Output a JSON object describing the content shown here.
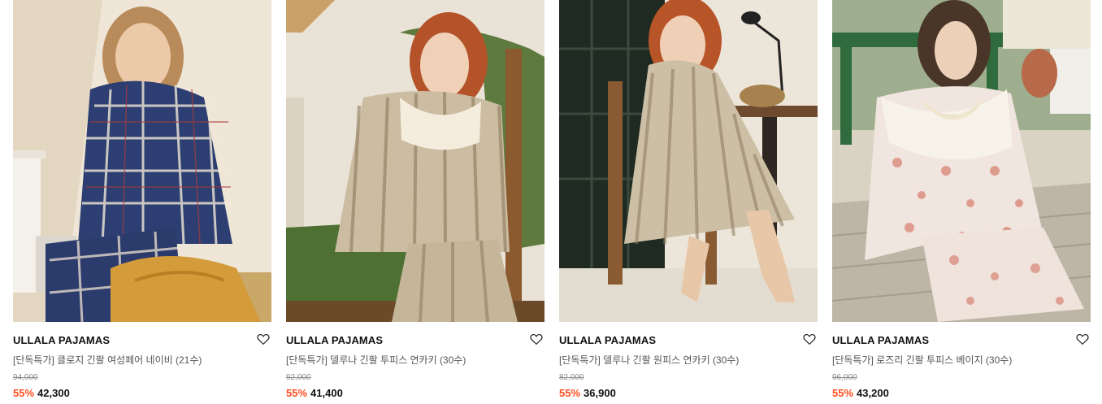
{
  "products": [
    {
      "brand": "ULLALA PAJAMAS",
      "title": "[단독특가] 클로지 긴팔 여성페어 네이비 (21수)",
      "original_price": "94,000",
      "discount_rate": "55%",
      "sale_price": "42,300",
      "wishlist_icon": "heart-outline-icon"
    },
    {
      "brand": "ULLALA PAJAMAS",
      "title": "[단독특가] 델루나 긴팔 투피스 연카키 (30수)",
      "original_price": "92,000",
      "discount_rate": "55%",
      "sale_price": "41,400",
      "wishlist_icon": "heart-outline-icon"
    },
    {
      "brand": "ULLALA PAJAMAS",
      "title": "[단독특가] 델루나 긴팔 원피스 연카키 (30수)",
      "original_price": "82,000",
      "discount_rate": "55%",
      "sale_price": "36,900",
      "wishlist_icon": "heart-outline-icon"
    },
    {
      "brand": "ULLALA PAJAMAS",
      "title": "[단독특가] 로즈리 긴팔 투피스 베이지 (30수)",
      "original_price": "96,000",
      "discount_rate": "55%",
      "sale_price": "43,200",
      "wishlist_icon": "heart-outline-icon"
    }
  ],
  "colors": {
    "discount": "#ff4d1f",
    "text": "#111111",
    "muted": "#8a8a8a"
  }
}
